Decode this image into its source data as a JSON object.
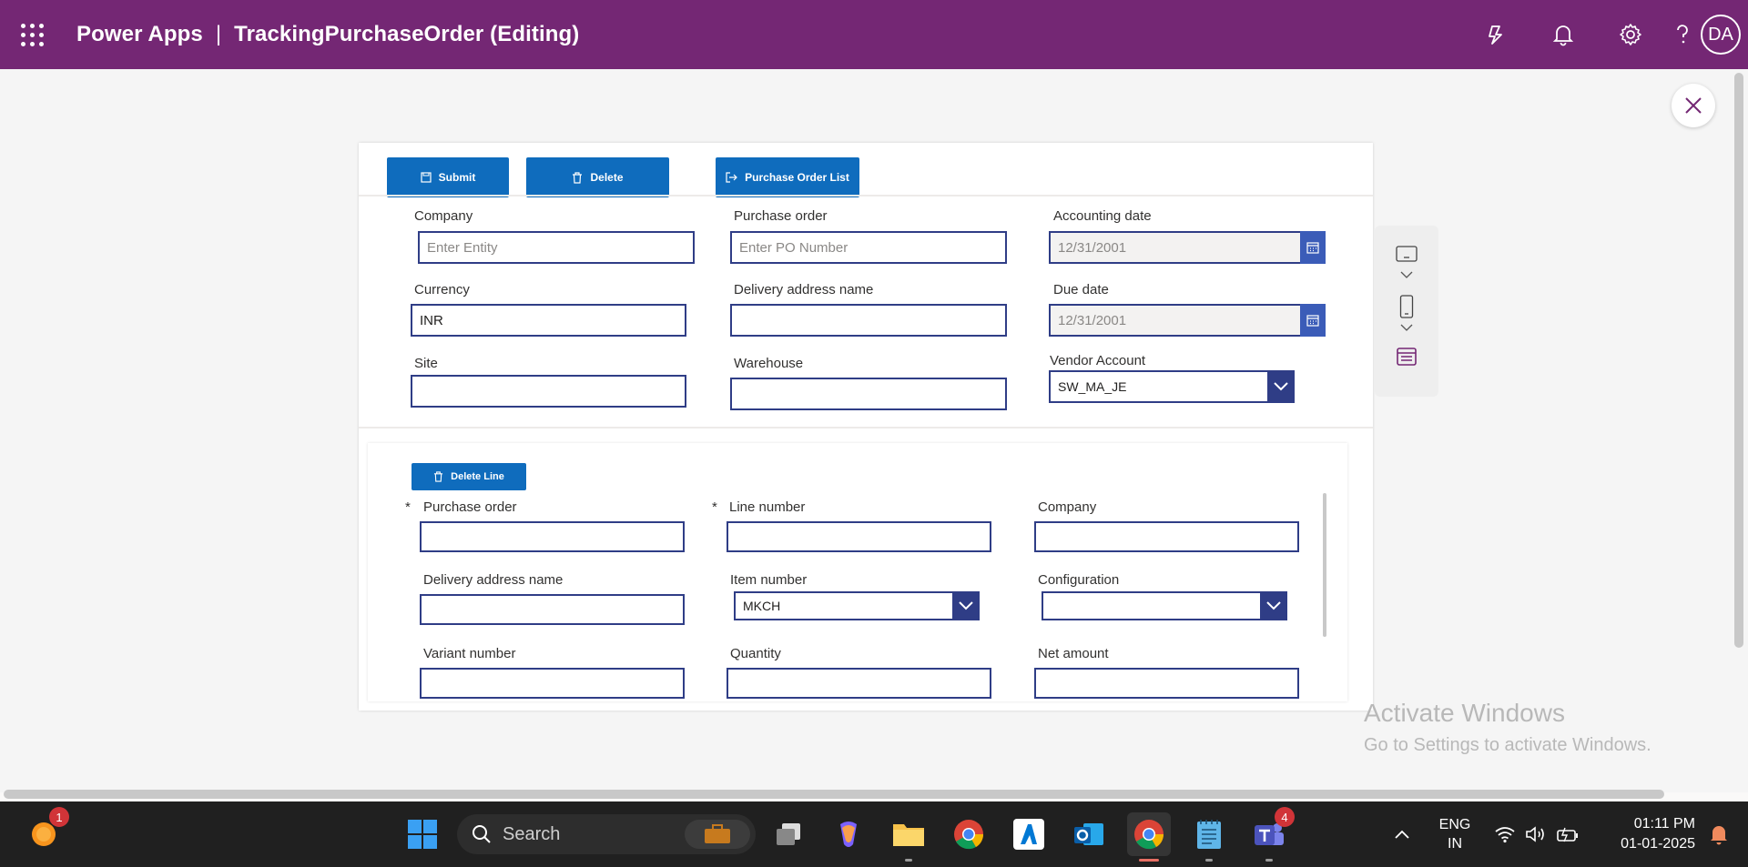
{
  "header": {
    "app_name": "Power Apps",
    "separator": "|",
    "doc_title": "TrackingPurchaseOrder (Editing)",
    "avatar_initials": "DA"
  },
  "toolbar": {
    "submit_label": "Submit",
    "delete_label": "Delete",
    "list_label": "Purchase Order List"
  },
  "header_form": {
    "company": {
      "label": "Company",
      "placeholder": "Enter Entity",
      "value": ""
    },
    "purchase_order": {
      "label": "Purchase order",
      "placeholder": "Enter PO Number",
      "value": ""
    },
    "accounting_date": {
      "label": "Accounting date",
      "value": "12/31/2001"
    },
    "currency": {
      "label": "Currency",
      "value": "INR"
    },
    "delivery_address_name": {
      "label": "Delivery address name",
      "value": ""
    },
    "due_date": {
      "label": "Due date",
      "value": "12/31/2001"
    },
    "site": {
      "label": "Site",
      "value": ""
    },
    "warehouse": {
      "label": "Warehouse",
      "value": ""
    },
    "vendor_account": {
      "label": "Vendor Account",
      "value": "SW_MA_JE"
    }
  },
  "line_form": {
    "delete_line_label": "Delete Line",
    "required_mark": "*",
    "purchase_order": {
      "label": "Purchase order",
      "value": ""
    },
    "line_number": {
      "label": "Line number",
      "value": ""
    },
    "company": {
      "label": "Company",
      "value": ""
    },
    "delivery_address_name": {
      "label": "Delivery address name",
      "value": ""
    },
    "item_number": {
      "label": "Item number",
      "value": "MKCH"
    },
    "configuration": {
      "label": "Configuration",
      "value": ""
    },
    "variant_number": {
      "label": "Variant number",
      "value": ""
    },
    "quantity": {
      "label": "Quantity",
      "value": ""
    },
    "net_amount": {
      "label": "Net amount",
      "value": ""
    }
  },
  "watermark": {
    "title": "Activate Windows",
    "subtitle": "Go to Settings to activate Windows."
  },
  "taskbar": {
    "search_label": "Search",
    "notification_badge": "1",
    "teams_badge": "4",
    "lang_line1": "ENG",
    "lang_line2": "IN",
    "time": "01:11 PM",
    "date": "01-01-2025"
  },
  "colors": {
    "header_bg": "#742774",
    "button_bg": "#0f6cbd",
    "input_border": "#2f3d86"
  }
}
